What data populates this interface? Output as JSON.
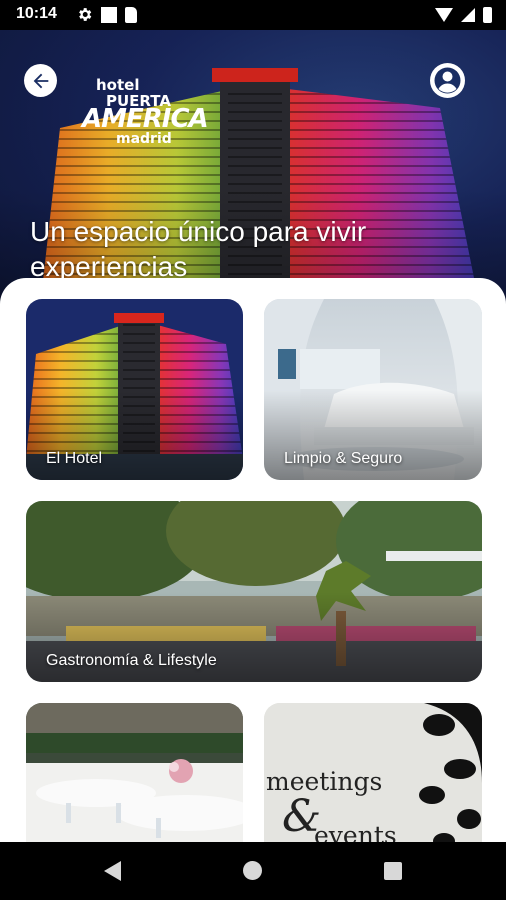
{
  "status_bar": {
    "time": "10:14",
    "icons": [
      "settings-icon",
      "notification-square-icon",
      "sd-card-icon",
      "wifi-icon",
      "signal-icon",
      "battery-icon"
    ]
  },
  "header": {
    "logo_hotel": "hotel",
    "logo_puerta": "PUERTA",
    "logo_america": "AMERICA",
    "logo_madrid": "madrid",
    "hero_title": "Un espacio único para vivir experiencias",
    "back_icon": "arrow-back-icon",
    "profile_icon": "account-circle-icon"
  },
  "cards": [
    {
      "label": "El Hotel"
    },
    {
      "label": "Limpio & Seguro"
    },
    {
      "label": "Gastronomía & Lifestyle"
    },
    {
      "label": ""
    },
    {
      "label": "",
      "image_text_1": "meetings",
      "image_text_2": "&",
      "image_text_3": "events"
    }
  ],
  "nav_bar": {
    "icons": [
      "nav-back-icon",
      "nav-home-icon",
      "nav-recents-icon"
    ]
  }
}
